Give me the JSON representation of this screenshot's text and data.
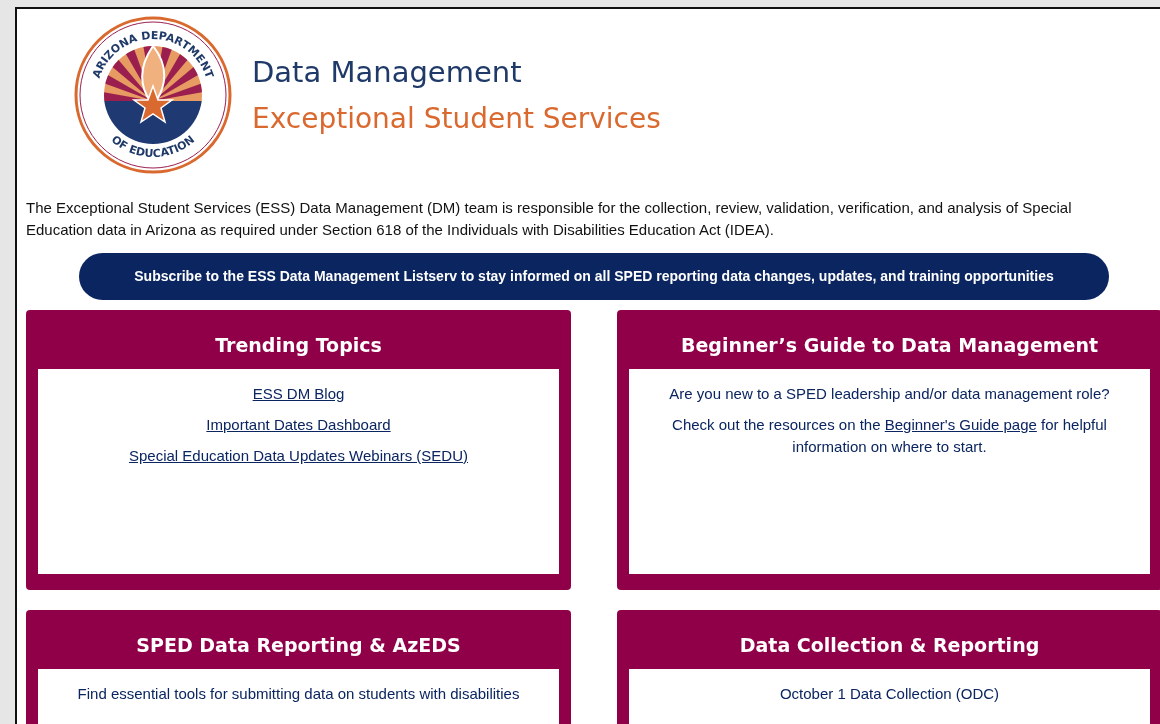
{
  "logo": {
    "top_text": "ARIZONA DEPARTMENT",
    "bottom_text": "OF EDUCATION"
  },
  "header": {
    "title": "Data Management",
    "subtitle": "Exceptional Student Services"
  },
  "intro": "The Exceptional Student Services (ESS) Data Management (DM) team is responsible for the collection, review, validation, verification, and analysis of Special Education data in Arizona as required under Section 618 of the Individuals with Disabilities Education Act (IDEA).",
  "subscribe_button": "Subscribe to the ESS Data Management Listserv to stay informed on all SPED reporting data changes, updates, and training opportunities",
  "cards": [
    {
      "title": "Trending Topics",
      "body": [
        {
          "kind": "link",
          "text": "ESS DM Blog"
        },
        {
          "kind": "link",
          "text": "Important Dates Dashboard"
        },
        {
          "kind": "link",
          "text": "Special Education Data Updates Webinars (SEDU)"
        }
      ]
    },
    {
      "title": "Beginner’s Guide to Data Management",
      "body": [
        {
          "kind": "text",
          "text": "Are you new to a SPED leadership and/or data management role?"
        },
        {
          "kind": "mixed",
          "before": "Check out the resources on the ",
          "link": "Beginner's Guide page",
          "after": " for helpful information on where to start."
        }
      ]
    },
    {
      "title": "SPED Data Reporting & AzEDS",
      "body": [
        {
          "kind": "text",
          "text": "Find essential tools for submitting data on students with disabilities"
        }
      ]
    },
    {
      "title": "Data Collection & Reporting",
      "body": [
        {
          "kind": "plain-link",
          "text": "October 1 Data Collection (ODC)"
        }
      ]
    }
  ]
}
